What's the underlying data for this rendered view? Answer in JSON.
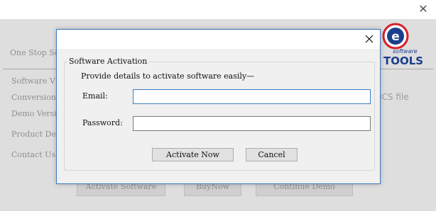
{
  "main_window": {
    "close_glyph": "✕",
    "brand_tagline_partial": "One Stop So",
    "sidebar_items": [
      {
        "label": "Software V"
      },
      {
        "label": "Conversion"
      },
      {
        "label": "Demo Versi"
      },
      {
        "label": "Product De"
      },
      {
        "label": "Contact Us"
      }
    ],
    "logo": {
      "letter": "e",
      "software_text": "software",
      "brand_text": "TOOLS"
    },
    "feature_partial": "ICS file",
    "buttons": {
      "activate_software": "Activate Software",
      "buy_now": "BuyNow",
      "continue_demo": "Continue Demo"
    },
    "colors": {
      "logo_blue": "#1a3e8c",
      "logo_red": "#d4202a"
    }
  },
  "dialog": {
    "close_glyph": "✕",
    "group_title": "Software Activation",
    "instruction": "Provide details to activate software easily—",
    "email": {
      "label": "Email:",
      "value": "",
      "placeholder": ""
    },
    "password": {
      "label": "Password:",
      "value": "",
      "placeholder": ""
    },
    "buttons": {
      "activate_now": "Activate Now",
      "cancel": "Cancel"
    },
    "colors": {
      "border": "#3b7dc4",
      "focus_border": "#3b7dc4"
    }
  }
}
